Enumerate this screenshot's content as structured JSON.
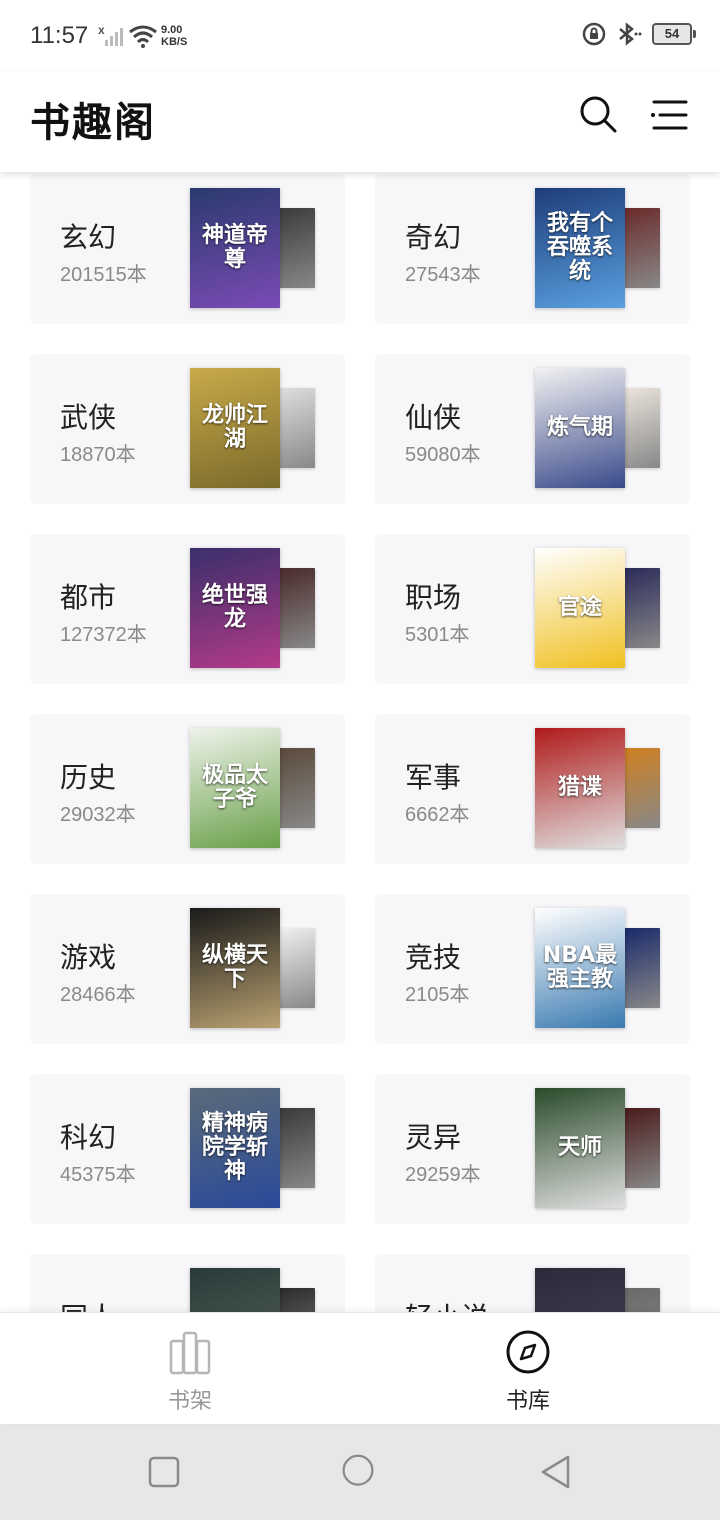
{
  "status_bar": {
    "time": "11:57",
    "speed_value": "9.00",
    "speed_unit": "KB/S",
    "battery": "54",
    "icons": [
      "signal-x-icon",
      "wifi-icon",
      "rotation-lock-icon",
      "bluetooth-icon",
      "battery-icon"
    ]
  },
  "header": {
    "title": "书趣阁",
    "icons": [
      "search-icon",
      "menu-icon"
    ]
  },
  "categories": [
    {
      "name": "玄幻",
      "count": "201515本",
      "cover_text": "神道帝尊",
      "front_color": "#2a3a6e",
      "front_color2": "#7a4bb5",
      "back_color": "#3b3b3b"
    },
    {
      "name": "奇幻",
      "count": "27543本",
      "cover_text": "我有个吞噬系统",
      "front_color": "#1e3d7a",
      "front_color2": "#5aa0e0",
      "back_color": "#6b2a2a"
    },
    {
      "name": "武侠",
      "count": "18870本",
      "cover_text": "龙帅江湖",
      "front_color": "#c9a94a",
      "front_color2": "#7a6a2a",
      "back_color": "#dedede"
    },
    {
      "name": "仙侠",
      "count": "59080本",
      "cover_text": "炼气期",
      "front_color": "#f2f2f2",
      "front_color2": "#3a4a8a",
      "back_color": "#eae4dc"
    },
    {
      "name": "都市",
      "count": "127372本",
      "cover_text": "绝世强龙",
      "front_color": "#3a2f6a",
      "front_color2": "#b33a8a",
      "back_color": "#4a2a2a"
    },
    {
      "name": "职场",
      "count": "5301本",
      "cover_text": "官途",
      "front_color": "#ffffff",
      "front_color2": "#f0c020",
      "back_color": "#2a2a5a"
    },
    {
      "name": "历史",
      "count": "29032本",
      "cover_text": "极品太子爷",
      "front_color": "#eef3ea",
      "front_color2": "#6aa04a",
      "back_color": "#5a4a3a"
    },
    {
      "name": "军事",
      "count": "6662本",
      "cover_text": "猎谍",
      "front_color": "#b01a1a",
      "front_color2": "#e0e0e0",
      "back_color": "#d08020"
    },
    {
      "name": "游戏",
      "count": "28466本",
      "cover_text": "纵横天下",
      "front_color": "#1a1a1a",
      "front_color2": "#b8a070",
      "back_color": "#f0f0f0"
    },
    {
      "name": "竞技",
      "count": "2105本",
      "cover_text": "NBA最强主教",
      "front_color": "#ffffff",
      "front_color2": "#3a7ab0",
      "back_color": "#1a2a6a"
    },
    {
      "name": "科幻",
      "count": "45375本",
      "cover_text": "精神病院学斩神",
      "front_color": "#5a6a7a",
      "front_color2": "#2a4a9a",
      "back_color": "#3a3a3a"
    },
    {
      "name": "灵异",
      "count": "29259本",
      "cover_text": "天师",
      "front_color": "#2a4a2a",
      "front_color2": "#e0e0e0",
      "back_color": "#4a1a1a"
    },
    {
      "name": "同人",
      "count": "",
      "cover_text": "",
      "front_color": "#2a3a3a",
      "front_color2": "#5a6a5a",
      "back_color": "#2a2a2a"
    },
    {
      "name": "轻小说",
      "count": "",
      "cover_text": "",
      "front_color": "#2a2a3a",
      "front_color2": "#4a4a5a",
      "back_color": "#6a6a6a"
    }
  ],
  "tabs": [
    {
      "label": "书架",
      "icon": "bookshelf-icon",
      "active": false
    },
    {
      "label": "书库",
      "icon": "compass-icon",
      "active": true
    }
  ],
  "system_nav": [
    "recents-square-icon",
    "home-circle-icon",
    "back-triangle-icon"
  ]
}
